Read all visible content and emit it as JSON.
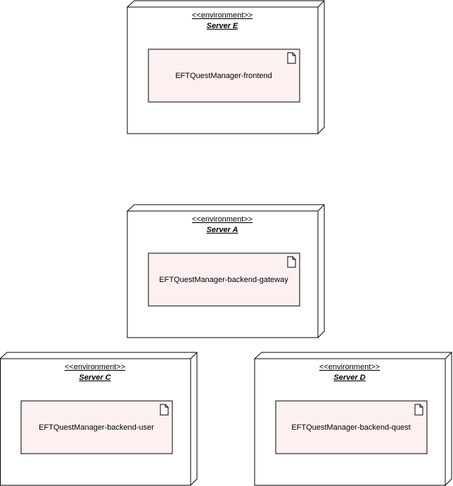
{
  "colors": {
    "node_fill": "#ffffff",
    "node_stroke": "#000000",
    "artifact_fill": "#fdf0f0",
    "artifact_stroke": "#000000"
  },
  "nodes": [
    {
      "id": "server-e",
      "stereotype": "<<environment>>",
      "name": "Server E",
      "artifact": {
        "name": "EFTQuestManager-frontend",
        "icon": "document-icon"
      }
    },
    {
      "id": "server-a",
      "stereotype": "<<environment>>",
      "name": "Server A",
      "artifact": {
        "name": "EFTQuestManager-backend-gateway",
        "icon": "document-icon"
      }
    },
    {
      "id": "server-c",
      "stereotype": "<<environment>>",
      "name": "Server C",
      "artifact": {
        "name": "EFTQuestManager-backend-user",
        "icon": "document-icon"
      }
    },
    {
      "id": "server-d",
      "stereotype": "<<environment>>",
      "name": "Server D",
      "artifact": {
        "name": "EFTQuestManager-backend-quest",
        "icon": "document-icon"
      }
    }
  ]
}
